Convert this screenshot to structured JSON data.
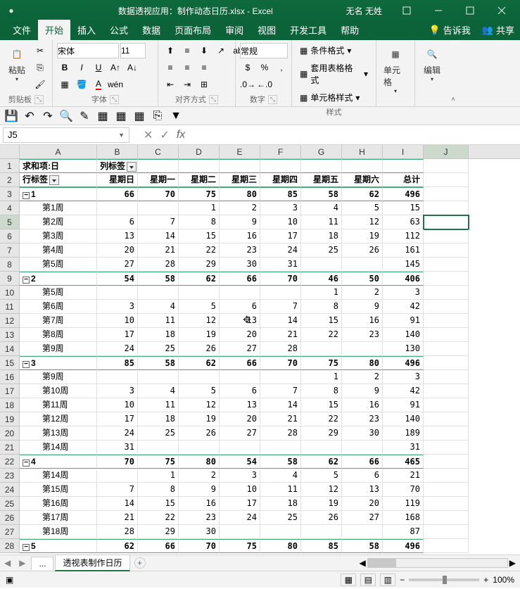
{
  "title": "数据透视应用：制作动态日历.xlsx - Excel",
  "user": "无名 无姓",
  "tabs": {
    "file": "文件",
    "home": "开始",
    "insert": "插入",
    "formulas": "公式",
    "data": "数据",
    "layout": "页面布局",
    "review": "审阅",
    "view": "视图",
    "dev": "开发工具",
    "help": "帮助",
    "tell": "告诉我",
    "share": "共享"
  },
  "ribbon": {
    "clipboard": {
      "label": "剪贴板",
      "paste": "粘贴"
    },
    "font": {
      "label": "字体",
      "name": "宋体",
      "size": "11"
    },
    "align": {
      "label": "对齐方式"
    },
    "number": {
      "label": "数字",
      "format": "常规"
    },
    "styles": {
      "label": "样式",
      "cond": "条件格式",
      "table": "套用表格格式",
      "cell": "单元格样式"
    },
    "cells": {
      "label": "单元格"
    },
    "editing": {
      "label": "编辑"
    }
  },
  "namebox": "J5",
  "colWidths": {
    "A": 110,
    "B": 58,
    "C": 58,
    "D": 58,
    "E": 58,
    "F": 58,
    "G": 58,
    "H": 58,
    "I": 58,
    "J": 64
  },
  "columns": [
    "A",
    "B",
    "C",
    "D",
    "E",
    "F",
    "G",
    "H",
    "I",
    "J"
  ],
  "selectedCell": {
    "row": 5,
    "col": "J"
  },
  "pivot": {
    "valueName": "求和项:日",
    "colLabelHdr": "列标签",
    "rowLabelHdr": "行标签",
    "dayHeaders": [
      "星期日",
      "星期一",
      "星期二",
      "星期三",
      "星期四",
      "星期五",
      "星期六",
      "总计"
    ],
    "rows": [
      {
        "t": "g",
        "lbl": "1",
        "v": [
          66,
          70,
          75,
          80,
          85,
          58,
          62,
          496
        ]
      },
      {
        "t": "d",
        "lbl": "第1周",
        "v": [
          "",
          "",
          1,
          2,
          3,
          4,
          5,
          15
        ]
      },
      {
        "t": "d",
        "lbl": "第2周",
        "v": [
          6,
          7,
          8,
          9,
          10,
          11,
          12,
          63
        ]
      },
      {
        "t": "d",
        "lbl": "第3周",
        "v": [
          13,
          14,
          15,
          16,
          17,
          18,
          19,
          112
        ]
      },
      {
        "t": "d",
        "lbl": "第4周",
        "v": [
          20,
          21,
          22,
          23,
          24,
          25,
          26,
          161
        ]
      },
      {
        "t": "d",
        "lbl": "第5周",
        "v": [
          27,
          28,
          29,
          30,
          31,
          "",
          "",
          145
        ]
      },
      {
        "t": "g",
        "lbl": "2",
        "v": [
          54,
          58,
          62,
          66,
          70,
          46,
          50,
          406
        ]
      },
      {
        "t": "d",
        "lbl": "第5周",
        "v": [
          "",
          "",
          "",
          "",
          "",
          1,
          2,
          3
        ]
      },
      {
        "t": "d",
        "lbl": "第6周",
        "v": [
          3,
          4,
          5,
          6,
          7,
          8,
          9,
          42
        ]
      },
      {
        "t": "d",
        "lbl": "第7周",
        "v": [
          10,
          11,
          12,
          13,
          14,
          15,
          16,
          91
        ]
      },
      {
        "t": "d",
        "lbl": "第8周",
        "v": [
          17,
          18,
          19,
          20,
          21,
          22,
          23,
          140
        ]
      },
      {
        "t": "d",
        "lbl": "第9周",
        "v": [
          24,
          25,
          26,
          27,
          28,
          "",
          "",
          130
        ]
      },
      {
        "t": "g",
        "lbl": "3",
        "v": [
          85,
          58,
          62,
          66,
          70,
          75,
          80,
          496
        ]
      },
      {
        "t": "d",
        "lbl": "第9周",
        "v": [
          "",
          "",
          "",
          "",
          "",
          1,
          2,
          3
        ]
      },
      {
        "t": "d",
        "lbl": "第10周",
        "v": [
          3,
          4,
          5,
          6,
          7,
          8,
          9,
          42
        ]
      },
      {
        "t": "d",
        "lbl": "第11周",
        "v": [
          10,
          11,
          12,
          13,
          14,
          15,
          16,
          91
        ]
      },
      {
        "t": "d",
        "lbl": "第12周",
        "v": [
          17,
          18,
          19,
          20,
          21,
          22,
          23,
          140
        ]
      },
      {
        "t": "d",
        "lbl": "第13周",
        "v": [
          24,
          25,
          26,
          27,
          28,
          29,
          30,
          189
        ]
      },
      {
        "t": "d",
        "lbl": "第14周",
        "v": [
          31,
          "",
          "",
          "",
          "",
          "",
          "",
          31
        ]
      },
      {
        "t": "g",
        "lbl": "4",
        "v": [
          70,
          75,
          80,
          54,
          58,
          62,
          66,
          465
        ]
      },
      {
        "t": "d",
        "lbl": "第14周",
        "v": [
          "",
          1,
          2,
          3,
          4,
          5,
          6,
          21
        ]
      },
      {
        "t": "d",
        "lbl": "第15周",
        "v": [
          7,
          8,
          9,
          10,
          11,
          12,
          13,
          70
        ]
      },
      {
        "t": "d",
        "lbl": "第16周",
        "v": [
          14,
          15,
          16,
          17,
          18,
          19,
          20,
          119
        ]
      },
      {
        "t": "d",
        "lbl": "第17周",
        "v": [
          21,
          22,
          23,
          24,
          25,
          26,
          27,
          168
        ]
      },
      {
        "t": "d",
        "lbl": "第18周",
        "v": [
          28,
          29,
          30,
          "",
          "",
          "",
          "",
          87
        ]
      },
      {
        "t": "g",
        "lbl": "5",
        "v": [
          62,
          66,
          70,
          75,
          80,
          85,
          58,
          496
        ]
      }
    ]
  },
  "sheets": {
    "ellipsis": "...",
    "active": "透视表制作日历"
  },
  "zoom": "100%"
}
